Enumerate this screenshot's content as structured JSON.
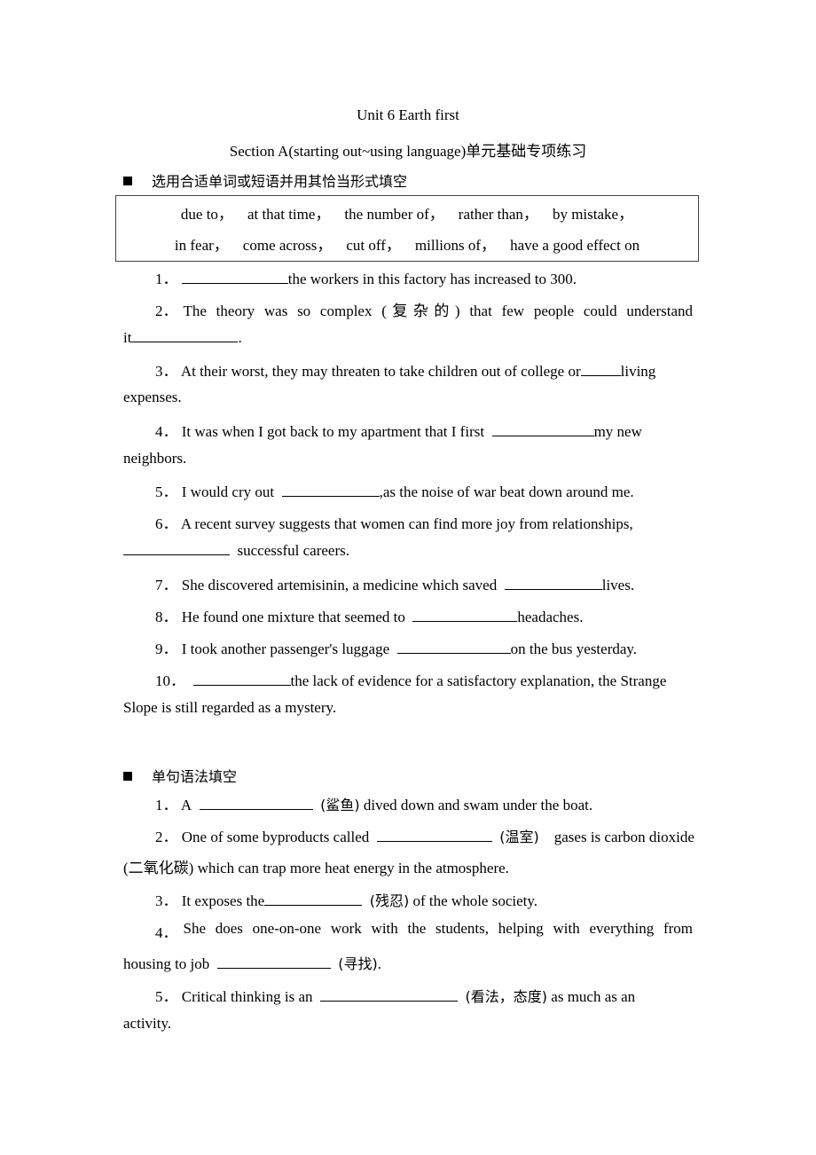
{
  "header": {
    "title": "Unit 6 Earth first",
    "subtitle": "Section A(starting out~using language)单元基础专项练习"
  },
  "section1": {
    "heading": "选用合适单词或短语并用其恰当形式填空",
    "word_bank_row1": [
      "due to，",
      "at that time，",
      "the number of，",
      "rather than，",
      "by mistake，"
    ],
    "word_bank_row2": [
      "in fear，",
      "come across，",
      "cut off，",
      "millions of，",
      "have a good effect on"
    ],
    "items": [
      {
        "num": "1．",
        "before": "",
        "after": "the workers in this factory has increased to 300."
      },
      {
        "num": "2．",
        "line1": "The theory was so complex (复杂的) that few people could understand",
        "before2": "it",
        "after2": "."
      },
      {
        "num": "3．",
        "line1_before": "At their worst, they may threaten to take children out of college or",
        "line1_after": "living",
        "line2": "expenses."
      },
      {
        "num": "4．",
        "line1_before": "It was when I got back to my apartment that I first",
        "line1_after": "my new",
        "line2": "neighbors."
      },
      {
        "num": "5．",
        "before": "I would cry out",
        "after": ",as the noise of war beat down around me."
      },
      {
        "num": "6．",
        "line1": "A recent survey suggests that women can find more joy from relationships,",
        "after2": "successful careers."
      },
      {
        "num": "7．",
        "before": "She discovered artemisinin, a medicine which saved",
        "after": "lives."
      },
      {
        "num": "8．",
        "before": "He found one mixture that seemed to",
        "after": "headaches."
      },
      {
        "num": "9．",
        "before": "I took another passenger's luggage",
        "after": "on the bus yesterday."
      },
      {
        "num": "10．",
        "line1_after": "the lack of evidence for a satisfactory explanation, the Strange",
        "line2": "Slope is still regarded as a mystery."
      }
    ]
  },
  "section2": {
    "heading": "单句语法填空",
    "items": [
      {
        "num": "1．",
        "before": "A",
        "hint": "(鲨鱼)",
        "after": "dived down and swam under the boat."
      },
      {
        "num": "2．",
        "before": "One of some byproducts called",
        "hint": "(温室)",
        "after": "gases is carbon dioxide",
        "line2": "(二氧化碳) which can trap more heat energy in the atmosphere."
      },
      {
        "num": "3．",
        "before": "It exposes the",
        "hint": "(残忍)",
        "after": "of the whole society."
      },
      {
        "num": "4．",
        "line1": "She does one-on-one work with the students, helping with everything from",
        "before2": "housing to job",
        "hint": "(寻找)",
        "after2": "."
      },
      {
        "num": "5．",
        "before": "Critical thinking is an",
        "hint": "(看法，态度)",
        "after": "as much as an",
        "line2": "activity."
      }
    ]
  }
}
